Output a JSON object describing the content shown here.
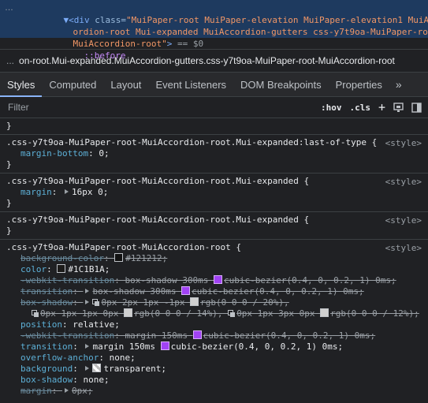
{
  "elements": {
    "line1_tag_open": "<div",
    "line1_attr": "class=",
    "line1_val": "\"MuiPaper-root MuiPaper-elevation MuiPaper-elevation1 MuiAcc",
    "line2_val": "ordion-root Mui-expanded MuiAccordion-gutters css-y7t9oa-MuiPaper-root-",
    "line3_val": "MuiAccordion-root\"",
    "line3_close": ">",
    "line3_eq": " == $0",
    "pseudo": "::before"
  },
  "breadcrumb": {
    "dots": "...",
    "text": "on-root.Mui-expanded.MuiAccordion-gutters.css-y7t9oa-MuiPaper-root-MuiAccordion-root"
  },
  "tabs": [
    "Styles",
    "Computed",
    "Layout",
    "Event Listeners",
    "DOM Breakpoints",
    "Properties"
  ],
  "tabs_more": "»",
  "filter": {
    "placeholder": "Filter",
    "hov": ":hov",
    "cls": ".cls",
    "plus": "+"
  },
  "rules": {
    "r0_close": "}",
    "r1": {
      "selector": ".css-y7t9oa-MuiPaper-root-MuiAccordion-root.Mui-expanded:last-of-type {",
      "source": "<style>",
      "p1_name": "margin-bottom",
      "p1_val": "0;",
      "close": "}"
    },
    "r2": {
      "selector": ".css-y7t9oa-MuiPaper-root-MuiAccordion-root.Mui-expanded {",
      "source": "<style>",
      "p1_name": "margin",
      "p1_val": "16px 0;",
      "close": "}"
    },
    "r3": {
      "selector": ".css-y7t9oa-MuiPaper-root-MuiAccordion-root.Mui-expanded {",
      "source": "<style>",
      "close": "}"
    },
    "r4": {
      "selector": ".css-y7t9oa-MuiPaper-root-MuiAccordion-root {",
      "source": "<style>",
      "bg_name": "background-color",
      "bg_val": "#121212;",
      "color_name": "color",
      "color_val": "#1C1B1A;",
      "wt_name": "-webkit-transition",
      "wt_val1": "box-shadow 300ms",
      "wt_val2": "cubic-bezier(0.4, 0, 0.2, 1) 0ms;",
      "tr_name": "transition",
      "tr_val1": "box-shadow 300ms",
      "tr_val2": "cubic-bezier(0.4, 0, 0.2, 1) 0ms;",
      "bs_name": "box-shadow",
      "bs_val1": "0px 2px 1px -1px",
      "bs_val2": "rgb(0 0 0 / 20%),",
      "bs_cont1": "0px 1px 1px 0px",
      "bs_cont2": "rgb(0 0 0 / 14%),",
      "bs_cont3": "0px 1px 3px 0px",
      "bs_cont4": "rgb(0 0 0 / 12%);",
      "pos_name": "position",
      "pos_val": "relative;",
      "wt2_name": "-webkit-transition",
      "wt2_val1": "margin 150ms",
      "wt2_val2": "cubic-bezier(0.4, 0, 0.2, 1) 0ms;",
      "tr2_name": "transition",
      "tr2_val1": "margin 150ms",
      "tr2_val2": "cubic-bezier(0.4, 0, 0.2, 1) 0ms;",
      "oa_name": "overflow-anchor",
      "oa_val": "none;",
      "bgd_name": "background",
      "bgd_val": "transparent;",
      "bs2_name": "box-shadow",
      "bs2_val": "none;",
      "m_name": "margin",
      "m_val": "0px;"
    }
  },
  "colors": {
    "background": "#202124",
    "selected_node": "#1e3a5f",
    "tab_indicator": "#8ab4f8",
    "prop_name": "#5db0d7",
    "swatch_purple": "#a142f4"
  }
}
